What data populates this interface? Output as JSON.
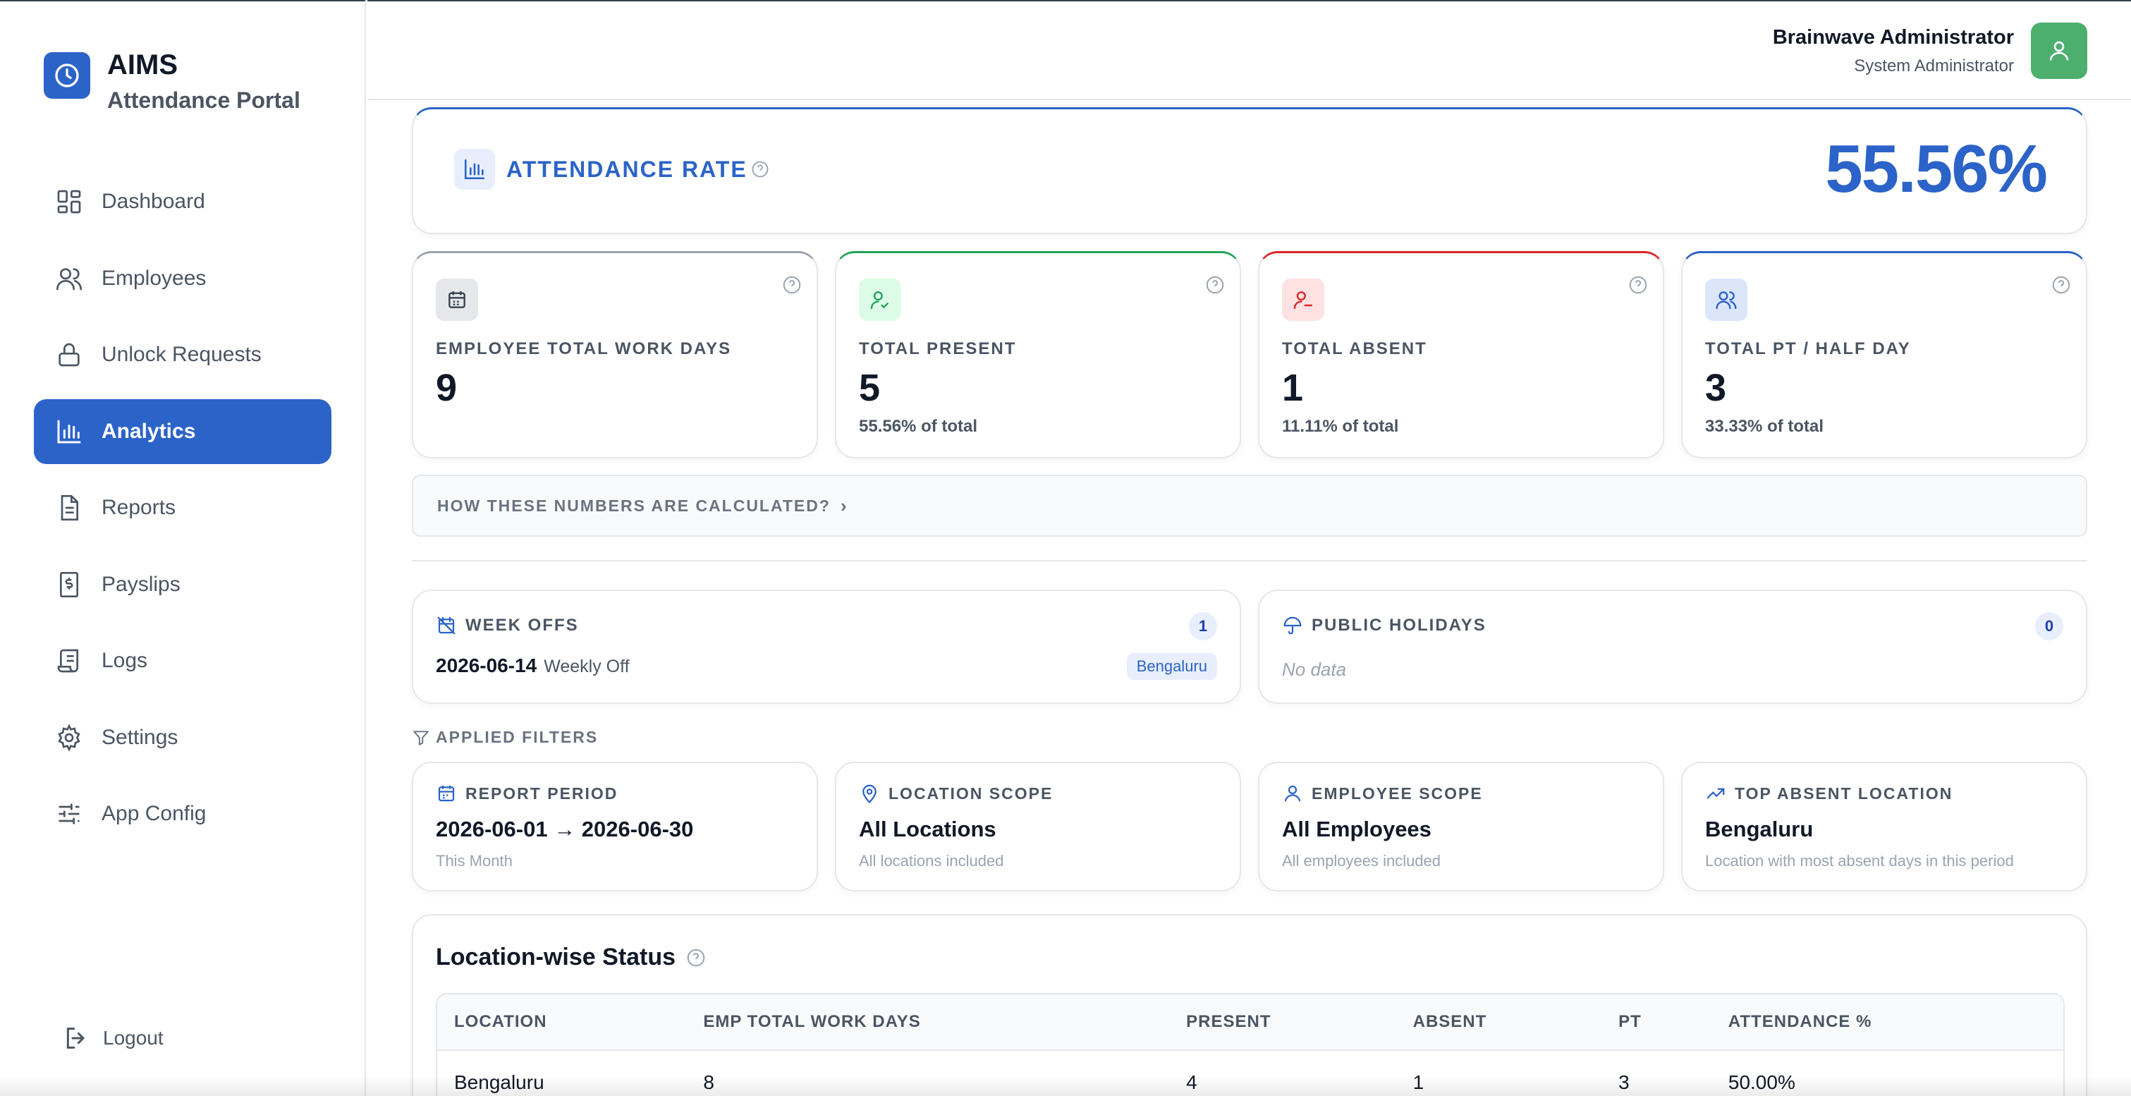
{
  "app": {
    "title": "AIMS",
    "subtitle": "Attendance Portal"
  },
  "sidebar": {
    "items": [
      {
        "label": "Dashboard",
        "icon": "dashboard-icon"
      },
      {
        "label": "Employees",
        "icon": "users-icon"
      },
      {
        "label": "Unlock Requests",
        "icon": "lock-icon"
      },
      {
        "label": "Analytics",
        "icon": "bar-chart-icon",
        "active": true
      },
      {
        "label": "Reports",
        "icon": "document-icon"
      },
      {
        "label": "Payslips",
        "icon": "payslip-icon"
      },
      {
        "label": "Logs",
        "icon": "scroll-icon"
      },
      {
        "label": "Settings",
        "icon": "gear-icon"
      },
      {
        "label": "App Config",
        "icon": "sliders-icon"
      }
    ],
    "logout": "Logout"
  },
  "header": {
    "user_name": "Brainwave Administrator",
    "user_role": "System Administrator"
  },
  "attendance_rate": {
    "label": "ATTENDANCE RATE",
    "value": "55.56%"
  },
  "stats": [
    {
      "label": "EMPLOYEE TOTAL WORK DAYS",
      "value": "9",
      "sub": "",
      "color": "#6b7280"
    },
    {
      "label": "TOTAL PRESENT",
      "value": "5",
      "sub": "55.56% of total",
      "color": "#22a35a"
    },
    {
      "label": "TOTAL ABSENT",
      "value": "1",
      "sub": "11.11% of total",
      "color": "#dc2626"
    },
    {
      "label": "TOTAL PT / HALF DAY",
      "value": "3",
      "sub": "33.33% of total",
      "color": "#2b63c8"
    }
  ],
  "calc_link": "HOW THESE NUMBERS ARE CALCULATED?",
  "week_offs": {
    "title": "WEEK OFFS",
    "count": "1",
    "date": "2026-06-14",
    "kind": "Weekly Off",
    "location": "Bengaluru"
  },
  "public_holidays": {
    "title": "PUBLIC HOLIDAYS",
    "count": "0",
    "empty": "No data"
  },
  "applied_filters": {
    "title": "APPLIED FILTERS",
    "items": [
      {
        "label": "REPORT PERIOD",
        "value": "2026-06-01 → 2026-06-30",
        "note": "This Month"
      },
      {
        "label": "LOCATION SCOPE",
        "value": "All Locations",
        "note": "All locations included"
      },
      {
        "label": "EMPLOYEE SCOPE",
        "value": "All Employees",
        "note": "All employees included"
      },
      {
        "label": "TOP ABSENT LOCATION",
        "value": "Bengaluru",
        "note": "Location with most absent days in this period"
      }
    ]
  },
  "location_status": {
    "title": "Location-wise Status",
    "columns": [
      "LOCATION",
      "EMP TOTAL WORK DAYS",
      "PRESENT",
      "ABSENT",
      "PT",
      "ATTENDANCE %"
    ],
    "rows": [
      [
        "Bengaluru",
        "8",
        "4",
        "1",
        "3",
        "50.00%"
      ]
    ]
  },
  "colors": {
    "accent": "#2b63c8",
    "avatar": "#4caf6e"
  }
}
